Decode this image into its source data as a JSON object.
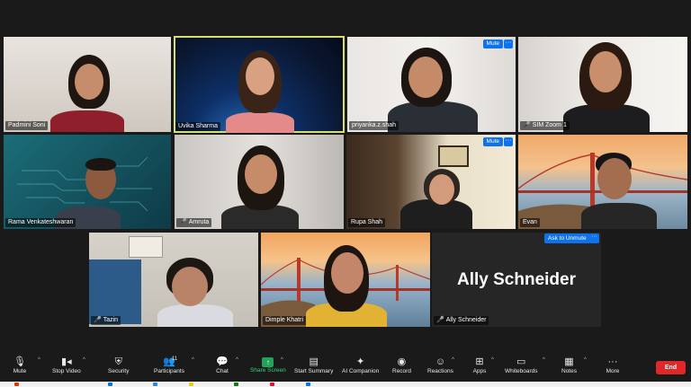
{
  "participants": [
    {
      "name": "Padmini Soni",
      "muted_mic": false,
      "mute_button": ""
    },
    {
      "name": "Uvika Sharma",
      "muted_mic": false,
      "mute_button": ""
    },
    {
      "name": "priyanka.z.shah",
      "muted_mic": false,
      "mute_button": "Mute"
    },
    {
      "name": "SIM Zoom 1",
      "muted_mic": true,
      "mute_button": ""
    },
    {
      "name": "Rama Venkateshwaran",
      "muted_mic": false,
      "mute_button": ""
    },
    {
      "name": "Amruta",
      "muted_mic": true,
      "mute_button": ""
    },
    {
      "name": "Rupa Shah",
      "muted_mic": false,
      "mute_button": "Mute"
    },
    {
      "name": "Evan",
      "muted_mic": false,
      "mute_button": ""
    },
    {
      "name": "Tazin",
      "muted_mic": true,
      "mute_button": ""
    },
    {
      "name": "Dimple Khatri",
      "muted_mic": false,
      "mute_button": ""
    },
    {
      "name": "Ally Schneider",
      "muted_mic": true,
      "mute_button": "",
      "display_name": "Ally Schneider",
      "ask_button": "Ask to Unmute",
      "more": "···"
    }
  ],
  "more_glyph": "···",
  "toolbar": {
    "mute": "Mute",
    "stop_video": "Stop Video",
    "security": "Security",
    "participants": "Participants",
    "participants_count": "11",
    "chat": "Chat",
    "share_screen": "Share Screen",
    "start_summary": "Start Summary",
    "ai_companion": "AI Companion",
    "record": "Record",
    "reactions": "Reactions",
    "apps": "Apps",
    "whiteboards": "Whiteboards",
    "notes": "Notes",
    "more": "More",
    "end": "End"
  },
  "colors": {
    "accent_blue": "#0e72ed",
    "end_red": "#e02828",
    "share_green": "#22a35a",
    "active_border": "#d7e06b"
  }
}
